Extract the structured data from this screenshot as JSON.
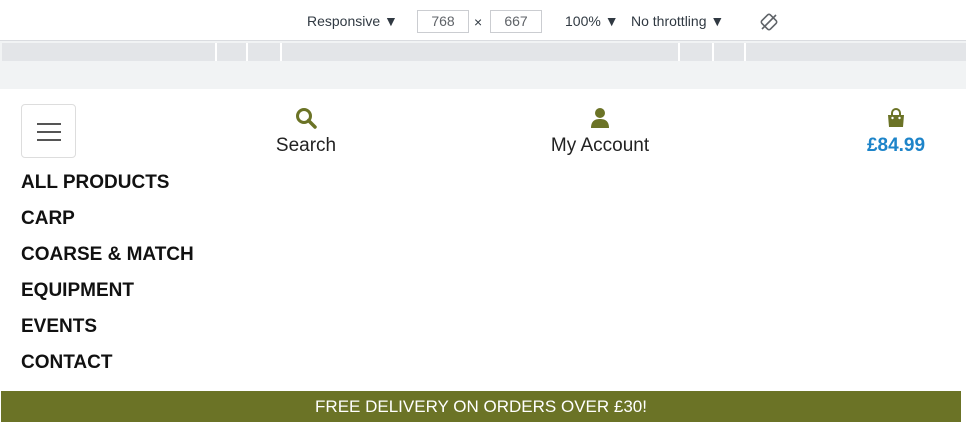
{
  "devtools": {
    "device_mode": "Responsive",
    "width": "768",
    "height": "667",
    "zoom": "100%",
    "throttling": "No throttling",
    "times": "×"
  },
  "site": {
    "search_label": "Search",
    "account_label": "My Account",
    "cart_total": "£84.99",
    "menu": [
      "ALL PRODUCTS",
      "CARP",
      "COARSE & MATCH",
      "EQUIPMENT",
      "EVENTS",
      "CONTACT"
    ],
    "banner_text": "FREE DELIVERY ON ORDERS OVER £30!"
  },
  "colors": {
    "accent_green": "#6b7326",
    "price_blue": "#1d84c9"
  },
  "icons": {
    "search": "search-icon",
    "account": "user-icon",
    "cart": "shopping-bag-icon",
    "menu": "hamburger-icon",
    "rotate": "rotate-icon"
  }
}
